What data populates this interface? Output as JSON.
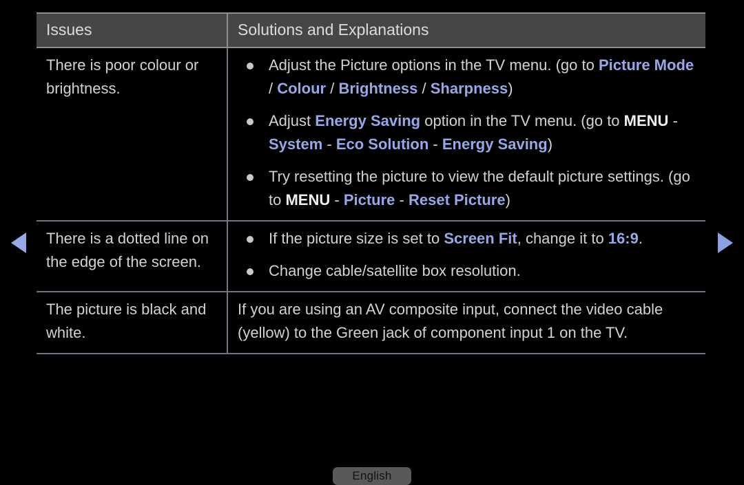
{
  "nav": {
    "prev_icon": "triangle-left-icon",
    "next_icon": "triangle-right-icon",
    "arrow_color": "#97a8e8"
  },
  "table": {
    "headers": {
      "issues": "Issues",
      "solutions": "Solutions and Explanations"
    },
    "rows": [
      {
        "issue": "There is poor colour or brightness.",
        "bullets": [
          {
            "segments": [
              {
                "text": "Adjust the Picture options in the TV menu. (go to ",
                "style": "normal"
              },
              {
                "text": "Picture Mode",
                "style": "highlight"
              },
              {
                "text": " / ",
                "style": "normal"
              },
              {
                "text": "Colour",
                "style": "highlight"
              },
              {
                "text": " / ",
                "style": "normal"
              },
              {
                "text": "Brightness",
                "style": "highlight"
              },
              {
                "text": " / ",
                "style": "normal"
              },
              {
                "text": "Sharpness",
                "style": "highlight"
              },
              {
                "text": ")",
                "style": "normal"
              }
            ]
          },
          {
            "segments": [
              {
                "text": "Adjust ",
                "style": "normal"
              },
              {
                "text": "Energy Saving",
                "style": "highlight"
              },
              {
                "text": " option in the TV menu. (go to ",
                "style": "normal"
              },
              {
                "text": "MENU",
                "style": "white-bold"
              },
              {
                "text": " - ",
                "style": "normal"
              },
              {
                "text": "System",
                "style": "highlight"
              },
              {
                "text": " - ",
                "style": "normal"
              },
              {
                "text": "Eco Solution",
                "style": "highlight"
              },
              {
                "text": " - ",
                "style": "normal"
              },
              {
                "text": "Energy Saving",
                "style": "highlight"
              },
              {
                "text": ")",
                "style": "normal"
              }
            ]
          },
          {
            "segments": [
              {
                "text": "Try resetting the picture to view the default picture settings. (go to ",
                "style": "normal"
              },
              {
                "text": "MENU",
                "style": "white-bold"
              },
              {
                "text": " - ",
                "style": "normal"
              },
              {
                "text": "Picture",
                "style": "highlight"
              },
              {
                "text": " - ",
                "style": "normal"
              },
              {
                "text": "Reset Picture",
                "style": "highlight"
              },
              {
                "text": ")",
                "style": "normal"
              }
            ]
          }
        ]
      },
      {
        "issue": "There is a dotted line on the edge of the screen.",
        "bullets": [
          {
            "segments": [
              {
                "text": "If the picture size is set to ",
                "style": "normal"
              },
              {
                "text": "Screen Fit",
                "style": "highlight"
              },
              {
                "text": ", change it to ",
                "style": "normal"
              },
              {
                "text": "16:9",
                "style": "highlight"
              },
              {
                "text": ".",
                "style": "normal"
              }
            ]
          },
          {
            "segments": [
              {
                "text": "Change cable/satellite box resolution.",
                "style": "normal"
              }
            ]
          }
        ]
      },
      {
        "issue": "The picture is black and white.",
        "paragraph": {
          "segments": [
            {
              "text": "If you are using an AV composite input, connect the video cable (yellow) to the Green jack of component input 1 on the TV.",
              "style": "normal"
            }
          ]
        }
      }
    ]
  },
  "footer": {
    "language_label": "English"
  }
}
